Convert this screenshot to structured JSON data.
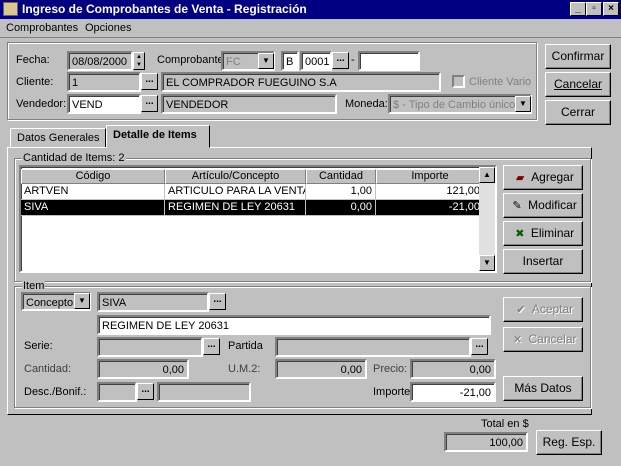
{
  "window": {
    "title": "Ingreso de Comprobantes de Venta - Registración",
    "min": "_",
    "max": "▫",
    "close": "×"
  },
  "menu": [
    {
      "label": "Comprobantes"
    },
    {
      "label": "Opciones"
    }
  ],
  "header": {
    "fecha_label": "Fecha:",
    "fecha_value": "08/08/2000",
    "comprobante_label": "Comprobante:",
    "comprobante_value": "FC",
    "letra_value": "B",
    "pto_venta_value": "0001",
    "numero_sep": "-",
    "numero_value": "",
    "cliente_label": "Cliente:",
    "cliente_code": "1",
    "cliente_name": "EL COMPRADOR FUEGUINO S.A",
    "cliente_vario_label": "Cliente Vario",
    "vendedor_label": "Vendedor:",
    "vendedor_code": "VEND",
    "vendedor_name": "VENDEDOR",
    "moneda_label": "Moneda:",
    "moneda_value": "$ - Tipo de Cambio único"
  },
  "actions": {
    "confirmar": "Confirmar",
    "cancelar": "Cancelar",
    "cerrar": "Cerrar"
  },
  "tabs": [
    {
      "label": "Datos Generales"
    },
    {
      "label": "Detalle de Items"
    }
  ],
  "items_group": {
    "title": "Cantidad de Items: 2",
    "columns": [
      "Código",
      "Artículo/Concepto",
      "Cantidad",
      "Importe"
    ],
    "rows": [
      {
        "codigo": "ARTVEN",
        "articulo": "ARTICULO PARA LA VENTA",
        "cantidad": "1,00",
        "importe": "121,00"
      },
      {
        "codigo": "SIVA",
        "articulo": "REGIMEN DE LEY 20631",
        "cantidad": "0,00",
        "importe": "-21,00"
      }
    ],
    "buttons": {
      "agregar": "Agregar",
      "modificar": "Modificar",
      "eliminar": "Eliminar",
      "insertar": "Insertar"
    }
  },
  "item_group": {
    "title": "Item",
    "tipo_value": "Concepto",
    "codigo_value": "SIVA",
    "descripcion_value": "REGIMEN DE LEY 20631",
    "serie_label": "Serie:",
    "partida_label": "Partida",
    "cantidad_label": "Cantidad:",
    "cantidad_value": "0,00",
    "um2_label": "U.M.2:",
    "um2_value": "0,00",
    "precio_label": "Precio:",
    "precio_value": "0,00",
    "desc_label": "Desc./Bonif.:",
    "importe_label": "Importe:",
    "importe_value": "-21,00",
    "aceptar": "Aceptar",
    "cancelar": "Cancelar",
    "mas_datos": "Más Datos"
  },
  "footer": {
    "total_label": "Total en $",
    "total_value": "100,00",
    "reg_esp": "Reg. Esp."
  },
  "icons": {
    "ellipsis": "...",
    "dropdown": "▼",
    "scroll_up": "▲",
    "scroll_down": "▼"
  }
}
